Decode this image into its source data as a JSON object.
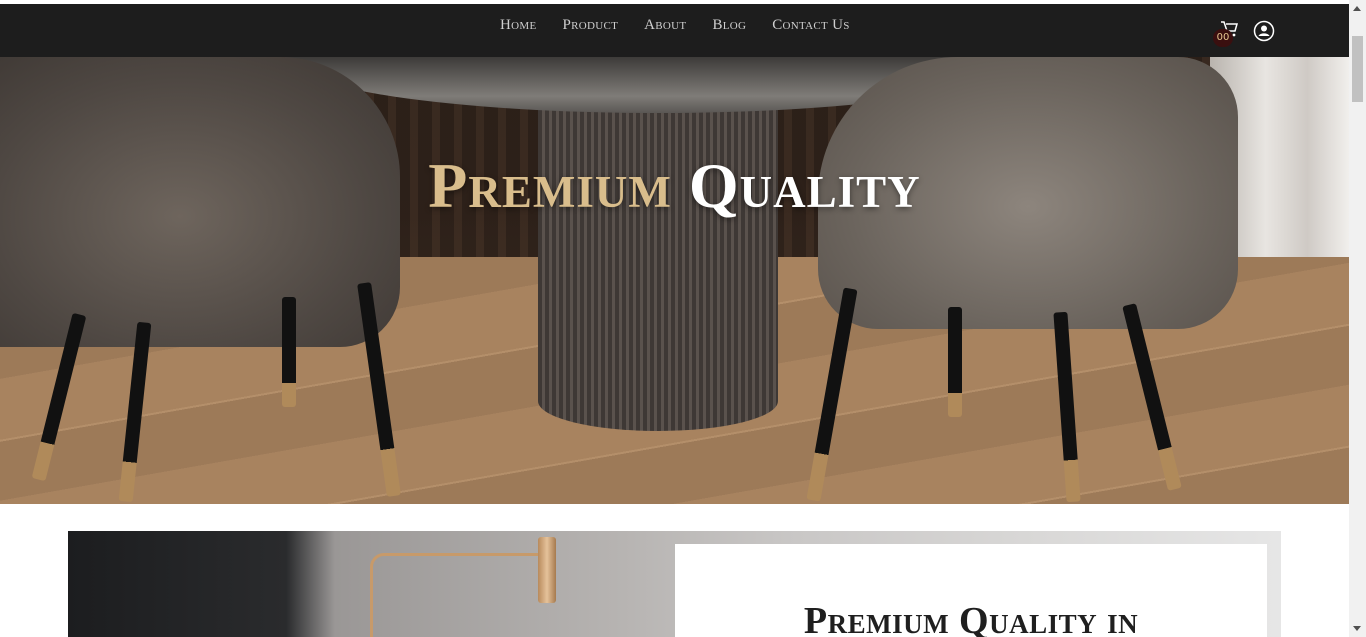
{
  "nav": {
    "items": [
      {
        "label": "Home"
      },
      {
        "label": "Product"
      },
      {
        "label": "About"
      },
      {
        "label": "Blog"
      },
      {
        "label": "Contact Us"
      }
    ],
    "cart_count": "00",
    "icons": {
      "cart": "cart-icon",
      "user": "user-icon"
    }
  },
  "hero": {
    "title_part1": "Premium",
    "title_part2": "Quality"
  },
  "feature": {
    "title": "Premium Quality in"
  },
  "colors": {
    "nav_bg": "#1d1d1d",
    "gold_accent": "#d9bd8c",
    "cart_badge_bg": "#3a0f0f"
  }
}
